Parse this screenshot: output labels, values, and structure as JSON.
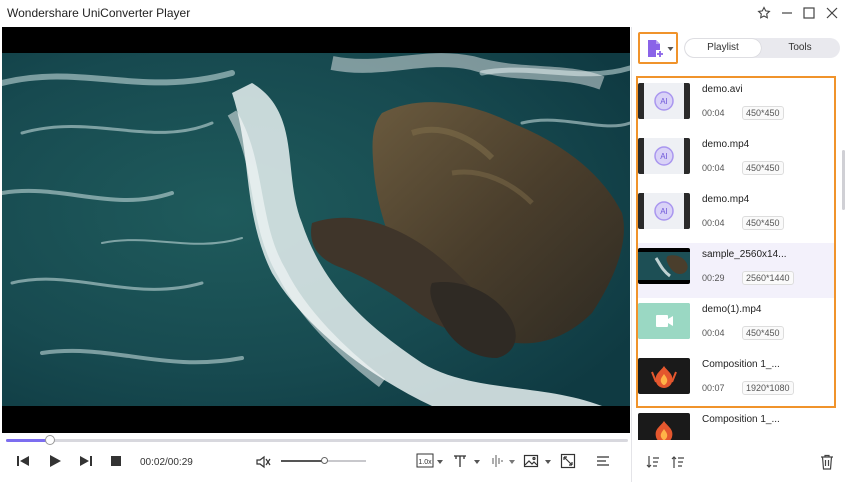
{
  "window": {
    "title": "Wondershare UniConverter Player"
  },
  "player": {
    "time": "00:02/00:29",
    "progress": 0.07,
    "volume": 0.5,
    "speed_label": "1.0x"
  },
  "panel": {
    "tabs": [
      {
        "label": "Playlist",
        "active": true
      },
      {
        "label": "Tools",
        "active": false
      }
    ]
  },
  "playlist": {
    "items": [
      {
        "name": "demo.avi",
        "duration": "00:04",
        "resolution": "450*450",
        "thumb": "ai-icon"
      },
      {
        "name": "demo.mp4",
        "duration": "00:04",
        "resolution": "450*450",
        "thumb": "ai-icon"
      },
      {
        "name": "demo.mp4",
        "duration": "00:04",
        "resolution": "450*450",
        "thumb": "ai-icon"
      },
      {
        "name": "sample_2560x14...",
        "duration": "00:29",
        "resolution": "2560*1440",
        "thumb": "ocean-frame",
        "selected": true
      },
      {
        "name": "demo(1).mp4",
        "duration": "00:04",
        "resolution": "450*450",
        "thumb": "video-icon"
      },
      {
        "name": "Composition 1_...",
        "duration": "00:07",
        "resolution": "1920*1080",
        "thumb": "flame-frame"
      }
    ],
    "overflow_item": {
      "name": "Composition 1_..."
    }
  },
  "colors": {
    "accent": "#7c6df0",
    "highlight_border": "#f0932b",
    "selected_row": "#f3f1fb"
  }
}
